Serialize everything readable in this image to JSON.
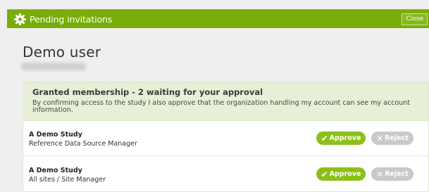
{
  "dialog": {
    "title": "Pending invitations",
    "close_label": "Close"
  },
  "user": {
    "name": "Demo user"
  },
  "membership": {
    "heading": "Granted membership - 2 waiting for your approval",
    "description": "By confirming access to the study I also approve that the organization handling my account can see my account information.",
    "items": [
      {
        "study": "A Demo Study",
        "role": "Reference Data Source Manager"
      },
      {
        "study": "A Demo Study",
        "role": "All sites / Site Manager"
      }
    ],
    "approve_label": "Approve",
    "reject_label": "Reject"
  },
  "colors": {
    "accent": "#78ad09",
    "approve": "#8bc01a",
    "reject": "#c9c9c9",
    "header_bg": "#e7f0d7"
  }
}
